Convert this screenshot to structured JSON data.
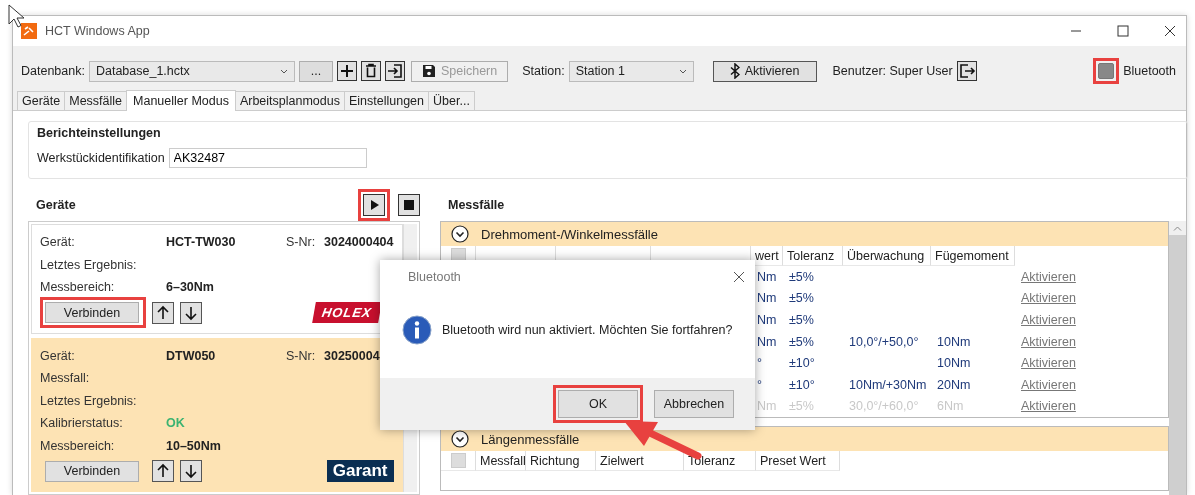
{
  "window": {
    "title": "HCT Windows App"
  },
  "toolbar": {
    "database_label": "Datenbank:",
    "database": "Database_1.hctx",
    "browse": "...",
    "save": "Speichern",
    "save_disabled": true,
    "station_label": "Station:",
    "station": "Station 1",
    "activate": "Aktivieren",
    "user": "Benutzer: Super User",
    "bluetooth": {
      "label": "Bluetooth",
      "checked": false,
      "highlighted": true
    }
  },
  "tabs": [
    {
      "label": "Geräte",
      "selected": false
    },
    {
      "label": "Messfälle",
      "selected": false
    },
    {
      "label": "Manueller Modus",
      "selected": true
    },
    {
      "label": "Arbeitsplanmodus",
      "selected": false
    },
    {
      "label": "Einstellungen",
      "selected": false
    },
    {
      "label": "Über...",
      "selected": false
    }
  ],
  "report": {
    "title": "Berichteinstellungen",
    "field_label": "Werkstückidentifikation",
    "field_value": "AK32487"
  },
  "devices": {
    "title": "Geräte",
    "play_highlighted": true,
    "cards": [
      {
        "selected": false,
        "device_label": "Gerät:",
        "device": "HCT-TW030",
        "serial_label": "S-Nr:",
        "serial": "3024000404",
        "fields": [
          {
            "label": "Letztes Ergebnis:"
          },
          {
            "label": "Messbereich:",
            "value": "6–30Nm",
            "kind": "plain"
          }
        ],
        "button": "Verbinden",
        "button_highlighted": true,
        "logo": {
          "kind": "holex",
          "text": "HOLEX"
        }
      },
      {
        "selected": true,
        "device_label": "Gerät:",
        "device": "DTW050",
        "serial_label": "S-Nr:",
        "serial": "30250004",
        "fields": [
          {
            "label": "Messfall:"
          },
          {
            "label": "Letztes Ergebnis:"
          },
          {
            "label": "Kalibrierstatus:",
            "value": "OK",
            "kind": "ok"
          },
          {
            "label": "Messbereich:",
            "value": "10–50Nm",
            "kind": "plain"
          }
        ],
        "button": "Verbinden",
        "button_highlighted": false,
        "logo": {
          "kind": "garant",
          "text": "Garant"
        }
      }
    ]
  },
  "cases": {
    "title": "Messfälle",
    "sections": [
      {
        "kind": "torque",
        "title": "Drehmoment-/Winkelmessfälle",
        "select_all_checked": false,
        "columns": [
          "wert",
          "Toleranz",
          "Überwachung",
          "Fügemoment"
        ],
        "rows": [
          {
            "cells": [
              "Nm",
              "±5%",
              "",
              ""
            ],
            "action": "Aktivieren",
            "disabled": false
          },
          {
            "cells": [
              "Nm",
              "±5%",
              "",
              ""
            ],
            "action": "Aktivieren",
            "disabled": false
          },
          {
            "cells": [
              "Nm",
              "±5%",
              "",
              ""
            ],
            "action": "Aktivieren",
            "disabled": false
          },
          {
            "cells": [
              "Nm",
              "±5%",
              "10,0°/+50,0°",
              "10Nm"
            ],
            "action": "Aktivieren",
            "disabled": false
          },
          {
            "cells": [
              "°",
              "±10°",
              "",
              "10Nm"
            ],
            "action": "Aktivieren",
            "disabled": false
          },
          {
            "cells": [
              "°",
              "±10°",
              "10Nm/+30Nm",
              "20Nm"
            ],
            "action": "Aktivieren",
            "disabled": false
          },
          {
            "cells": [
              "Nm",
              "±5%",
              "30,0°/+60,0°",
              "6Nm"
            ],
            "action": "Aktivieren",
            "disabled": true
          }
        ]
      },
      {
        "kind": "length",
        "title": "Längenmessfälle",
        "select_all_checked": false,
        "columns": [
          "Messfall",
          "Richtung",
          "Zielwert",
          "Toleranz",
          "Preset Wert"
        ]
      }
    ]
  },
  "dialog": {
    "title": "Bluetooth",
    "message": "Bluetooth wird nun aktiviert. Möchten Sie fortfahren?",
    "buttons": [
      {
        "label": "OK",
        "highlighted": true
      },
      {
        "label": "Abbrechen",
        "highlighted": false
      }
    ]
  }
}
